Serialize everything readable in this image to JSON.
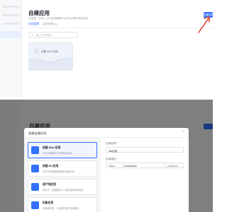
{
  "top": {
    "title": "自建应用",
    "description": "在这里，Web、H5 应用和使用 ycSkey 等开发的应用",
    "tabs": [
      {
        "label": "应用管理",
        "active": true
      },
      {
        "label": "自开发者 (1)",
        "active": false
      }
    ],
    "search_placeholder": "输入名称搜索",
    "app_card": {
      "name": "创建 Web 应用"
    },
    "create_button": "创建应用"
  },
  "bottom": {
    "title": "自建应用",
    "modal": {
      "title": "创建自建应用",
      "close_icon": "close-icon",
      "options": [
        {
          "title": "创建 Web 应用",
          "desc": "可在浏览器中打开的网页应用",
          "selected": true
        },
        {
          "title": "创建 H5 应用",
          "desc": "可在手机端快速搭建的页面应用",
          "selected": false
        },
        {
          "title": "原产地应用",
          "desc": "原生可、控制器及以入或功能使用的应用",
          "selected": false
        },
        {
          "title": "扣账应用",
          "desc": "可随身携带，订阅或在某些领域使用",
          "selected": false
        }
      ],
      "fields": [
        {
          "label": "应用名称 *",
          "value": "test应用"
        },
        {
          "label": "应用域名 *",
          "prefix": "https://",
          "value": "yourdomain",
          "suffix": ".ycSkey.cn"
        }
      ]
    }
  },
  "colors": {
    "accent": "#3370ff",
    "arrow": "#e54d42",
    "overlay": "rgba(0,0,0,0.5)"
  }
}
